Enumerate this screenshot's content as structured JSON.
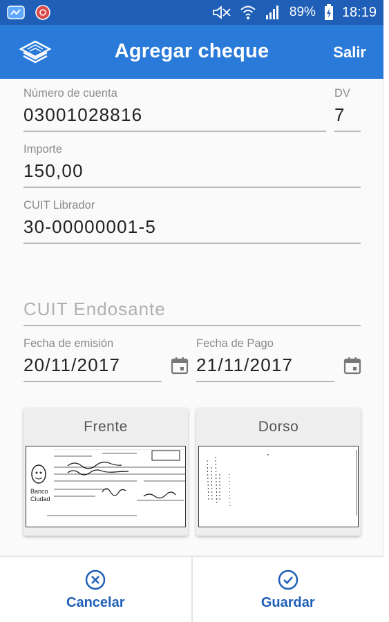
{
  "status_bar": {
    "battery": "89%",
    "time": "18:19"
  },
  "app_bar": {
    "title": "Agregar cheque",
    "exit_label": "Salir"
  },
  "form": {
    "account_number": {
      "label": "Número de cuenta",
      "value": "03001028816"
    },
    "dv": {
      "label": "DV",
      "value": "7"
    },
    "amount": {
      "label": "Importe",
      "value": "150,00"
    },
    "cuit_drawer": {
      "label": "CUIT Librador",
      "value": "30-00000001-5"
    },
    "cuit_endorser": {
      "placeholder": "CUIT Endosante"
    },
    "issue_date": {
      "label": "Fecha de emisión",
      "value": "20/11/2017"
    },
    "payment_date": {
      "label": "Fecha de Pago",
      "value": "21/11/2017"
    }
  },
  "images": {
    "front_label": "Frente",
    "back_label": "Dorso"
  },
  "actions": {
    "cancel_label": "Cancelar",
    "save_label": "Guardar"
  },
  "colors": {
    "status_bar": "#1f5fb8",
    "app_bar": "#2a7ad9",
    "accent": "#1f5fb8"
  }
}
